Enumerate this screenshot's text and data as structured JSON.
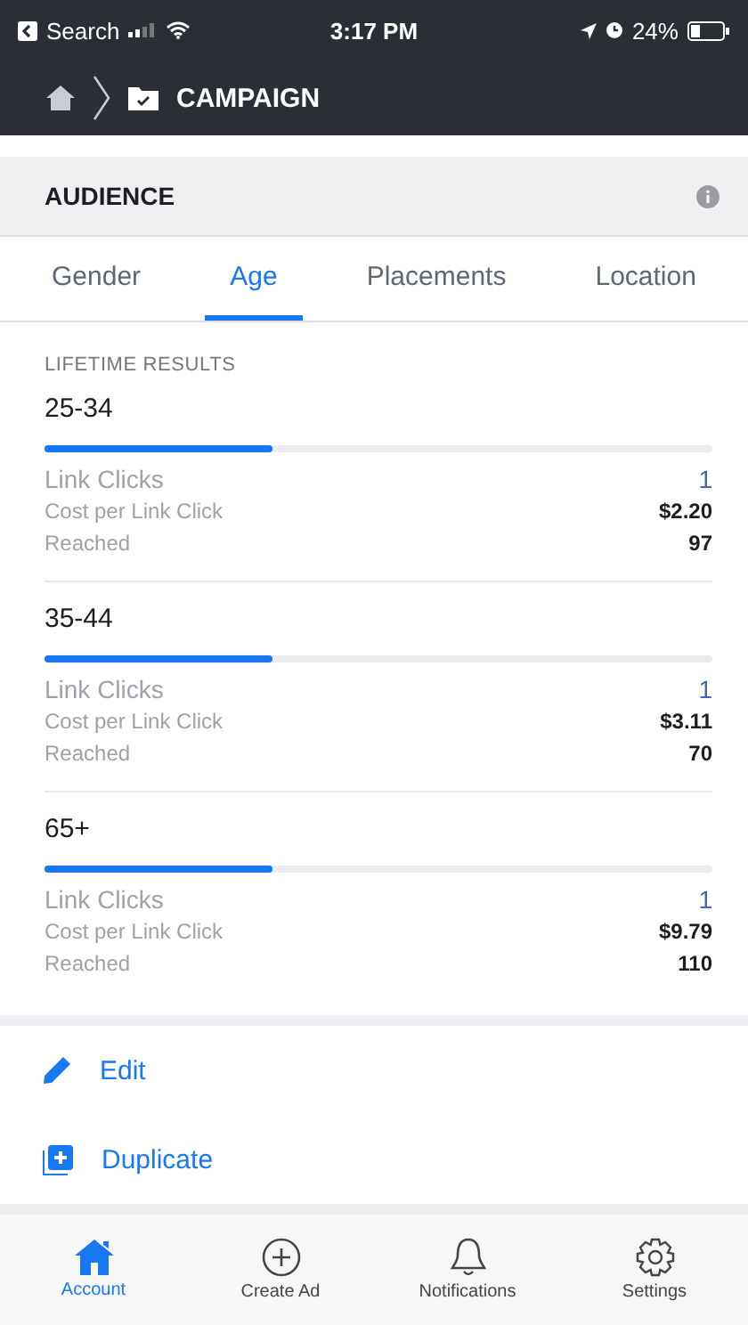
{
  "status_bar": {
    "back_label": "Search",
    "time": "3:17 PM",
    "battery": "24%"
  },
  "nav": {
    "title": "CAMPAIGN"
  },
  "section": {
    "title": "AUDIENCE"
  },
  "tabs": [
    {
      "label": "Gender",
      "selected": false
    },
    {
      "label": "Age",
      "selected": true
    },
    {
      "label": "Placements",
      "selected": false
    },
    {
      "label": "Location",
      "selected": false
    }
  ],
  "results_label": "LIFETIME RESULTS",
  "groups": [
    {
      "name": "25-34",
      "level": 0.34,
      "metrics": [
        {
          "label": "Link Clicks",
          "value": "1",
          "kind": "primary"
        },
        {
          "label": "Cost per Link Click",
          "value": "$2.20",
          "kind": "secondary"
        },
        {
          "label": "Reached",
          "value": "97",
          "kind": "secondary"
        }
      ]
    },
    {
      "name": "35-44",
      "level": 0.34,
      "metrics": [
        {
          "label": "Link Clicks",
          "value": "1",
          "kind": "primary"
        },
        {
          "label": "Cost per Link Click",
          "value": "$3.11",
          "kind": "secondary"
        },
        {
          "label": "Reached",
          "value": "70",
          "kind": "secondary"
        }
      ]
    },
    {
      "name": "65+",
      "level": 0.34,
      "metrics": [
        {
          "label": "Link Clicks",
          "value": "1",
          "kind": "primary"
        },
        {
          "label": "Cost per Link Click",
          "value": "$9.79",
          "kind": "secondary"
        },
        {
          "label": "Reached",
          "value": "110",
          "kind": "secondary"
        }
      ]
    }
  ],
  "actions": [
    {
      "label": "Edit",
      "kind": "edit"
    },
    {
      "label": "Duplicate",
      "kind": "duplicate"
    }
  ],
  "tab_bar": [
    {
      "label": "Account",
      "kind": "home",
      "selected": true
    },
    {
      "label": "Create Ad",
      "kind": "add",
      "selected": false
    },
    {
      "label": "Notifications",
      "kind": "bell",
      "selected": false
    },
    {
      "label": "Settings",
      "kind": "gear",
      "selected": false
    }
  ]
}
